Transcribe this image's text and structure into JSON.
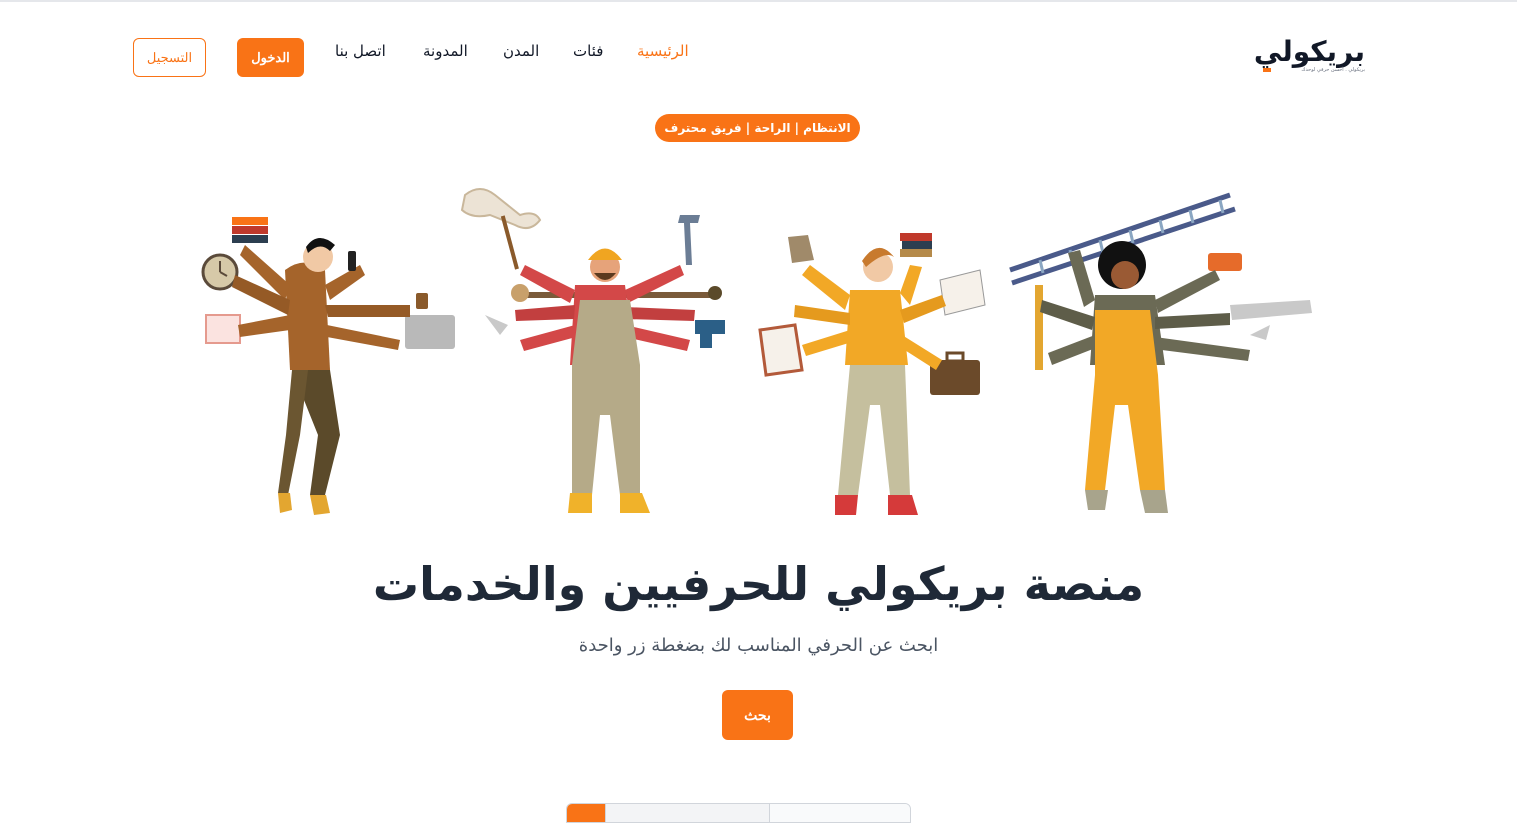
{
  "brand": {
    "name": "بريكولي",
    "tagline": "بريكولي . أحسن حرفي لوحدك",
    "accent": "#f97316"
  },
  "nav": {
    "home": "الرئيسية",
    "categories": "فئات",
    "cities": "المدن",
    "blog": "المدونة",
    "contact": "اتصل بنا"
  },
  "auth": {
    "login": "الدخول",
    "register": "التسجيل"
  },
  "hero": {
    "badge": "الانتظام | الراحة | فريق محترف",
    "title": "منصة بريكولي للحرفيين والخدمات",
    "subtitle": "ابحث عن الحرفي المناسب لك بضغطة زر واحدة",
    "search_button": "بحث"
  }
}
